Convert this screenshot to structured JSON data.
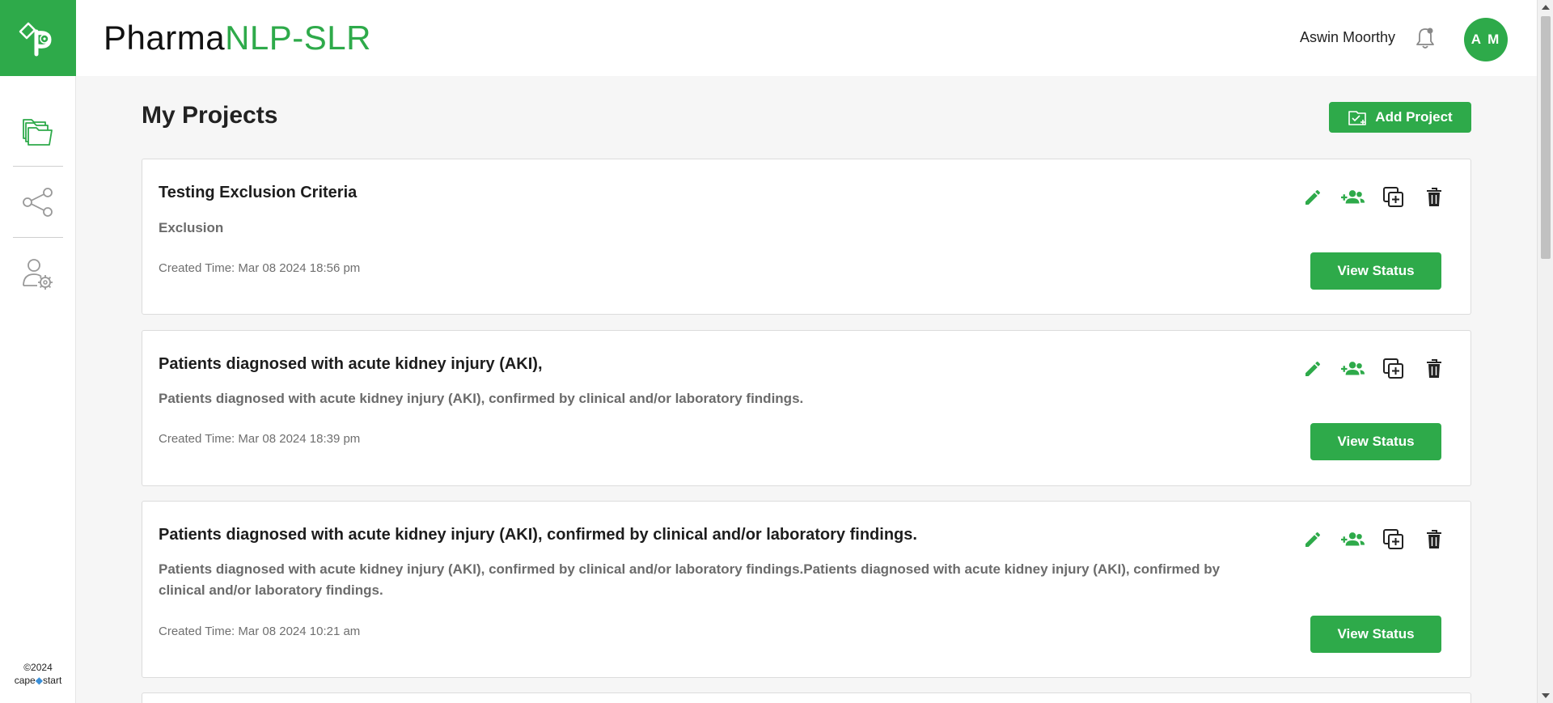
{
  "app": {
    "title_part1": "Pharma",
    "title_part2": "NLP-SLR",
    "accent_color": "#2eaa4a"
  },
  "header": {
    "user_name": "Aswin Moorthy",
    "avatar_initials": "A M",
    "notification_icon": "bell-icon"
  },
  "sidebar": {
    "items": [
      {
        "name": "projects",
        "icon": "folders-icon"
      },
      {
        "name": "share",
        "icon": "share-icon"
      },
      {
        "name": "user-settings",
        "icon": "user-gear-icon"
      }
    ],
    "footer_copyright": "©2024",
    "footer_brand_left": "cape",
    "footer_brand_right": "start"
  },
  "main": {
    "page_title": "My Projects",
    "add_button_label": "Add Project",
    "view_status_label": "View Status",
    "projects": [
      {
        "title": "Testing Exclusion Criteria",
        "description": "Exclusion",
        "created": "Created Time: Mar 08 2024 18:56 pm"
      },
      {
        "title": "Patients diagnosed with acute kidney injury (AKI),",
        "description": "Patients diagnosed with acute kidney injury (AKI), confirmed by clinical and/or laboratory findings.",
        "created": "Created Time: Mar 08 2024 18:39 pm"
      },
      {
        "title": "Patients diagnosed with acute kidney injury (AKI), confirmed by clinical and/or laboratory findings.",
        "description": "Patients diagnosed with acute kidney injury (AKI), confirmed by clinical and/or laboratory findings.Patients diagnosed with acute kidney injury (AKI), confirmed by clinical and/or laboratory findings.",
        "created": "Created Time: Mar 08 2024 10:21 am"
      }
    ]
  }
}
